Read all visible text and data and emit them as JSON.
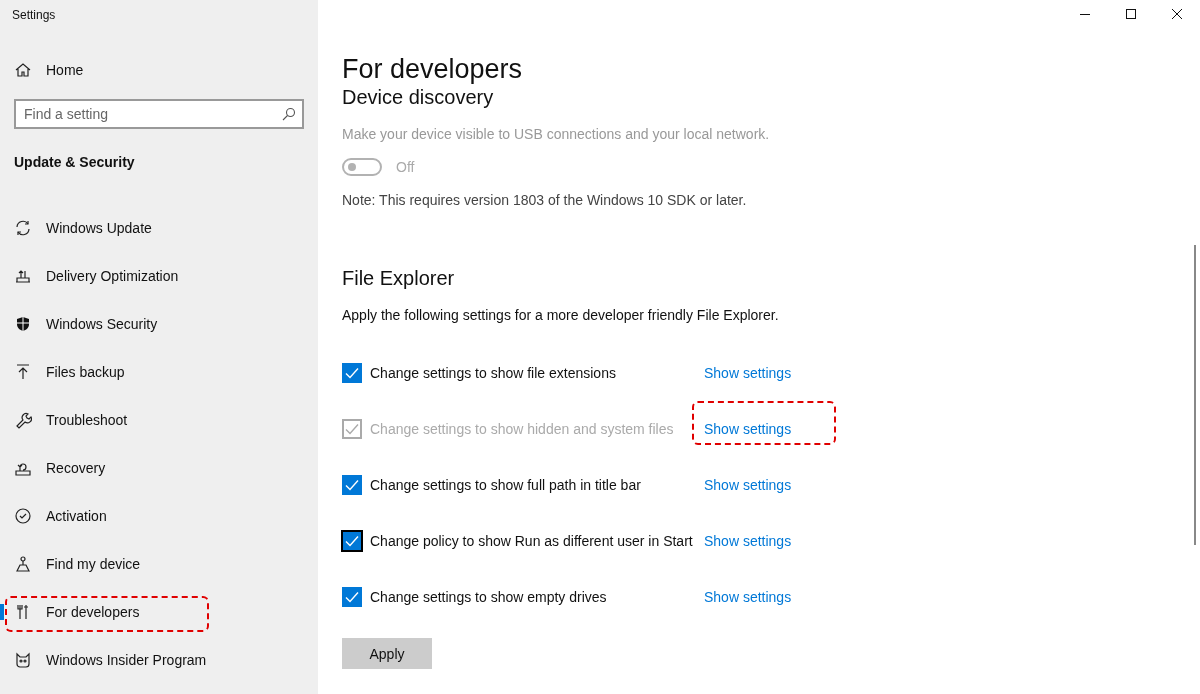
{
  "window": {
    "title": "Settings"
  },
  "sidebar": {
    "home": "Home",
    "search": {
      "placeholder": "Find a setting"
    },
    "section": "Update & Security",
    "items": [
      {
        "label": "Windows Update",
        "selected": false,
        "annotated": false
      },
      {
        "label": "Delivery Optimization",
        "selected": false,
        "annotated": false
      },
      {
        "label": "Windows Security",
        "selected": false,
        "annotated": false
      },
      {
        "label": "Files backup",
        "selected": false,
        "annotated": false
      },
      {
        "label": "Troubleshoot",
        "selected": false,
        "annotated": false
      },
      {
        "label": "Recovery",
        "selected": false,
        "annotated": false
      },
      {
        "label": "Activation",
        "selected": false,
        "annotated": false
      },
      {
        "label": "Find my device",
        "selected": false,
        "annotated": false
      },
      {
        "label": "For developers",
        "selected": true,
        "annotated": true
      },
      {
        "label": "Windows Insider Program",
        "selected": false,
        "annotated": false
      }
    ]
  },
  "page": {
    "title": "For developers",
    "device_discovery": {
      "heading": "Device discovery",
      "description": "Make your device visible to USB connections and your local network.",
      "toggle": {
        "on": false,
        "disabled": true,
        "label": "Off"
      },
      "note": "Note: This requires version 1803 of the Windows 10 SDK or later."
    },
    "file_explorer": {
      "heading": "File Explorer",
      "description": "Apply the following settings for a more developer friendly File Explorer.",
      "rows": [
        {
          "label": "Change settings to show file extensions",
          "checked": true,
          "disabled": false,
          "focused": false,
          "link": "Show settings",
          "annotated": false
        },
        {
          "label": "Change settings to show hidden and system files",
          "checked": true,
          "disabled": true,
          "focused": false,
          "link": "Show settings",
          "annotated": true
        },
        {
          "label": "Change settings to show full path in title bar",
          "checked": true,
          "disabled": false,
          "focused": false,
          "link": "Show settings",
          "annotated": false
        },
        {
          "label": "Change policy to show Run as different user in Start",
          "checked": true,
          "disabled": false,
          "focused": true,
          "link": "Show settings",
          "annotated": false
        },
        {
          "label": "Change settings to show empty drives",
          "checked": true,
          "disabled": false,
          "focused": false,
          "link": "Show settings",
          "annotated": false
        }
      ],
      "apply": "Apply"
    }
  }
}
